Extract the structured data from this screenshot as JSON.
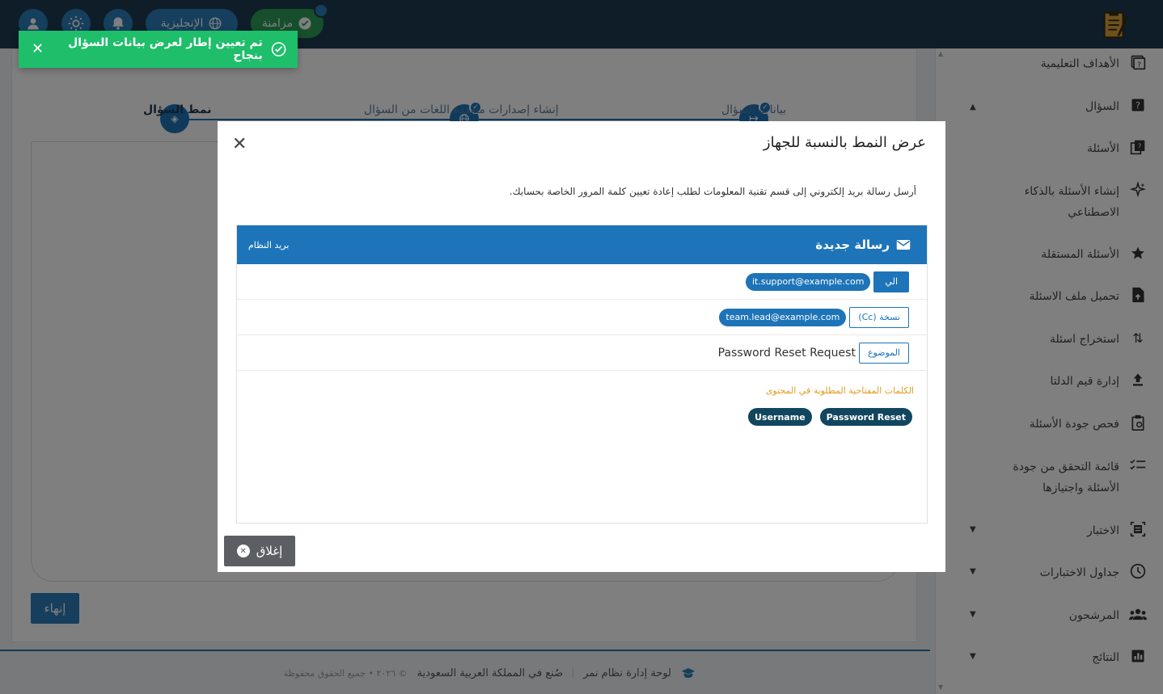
{
  "topbar": {
    "sync_label": "مزامنة",
    "language_label": "الإنجليزية"
  },
  "toast": {
    "message": "تم تعيين إطار لعرض بيانات السؤال بنجاح"
  },
  "stepper": {
    "steps": [
      {
        "label": "بيانات السؤال"
      },
      {
        "label": "إنشاء إصدارات متعددة اللغات من السؤال"
      },
      {
        "label": "نمط السؤال"
      }
    ]
  },
  "main": {
    "finish_label": "إنهاء"
  },
  "footer": {
    "app_name": "لوحة إدارة نظام نمر",
    "made_in": "صُنع في المملكة العربية السعودية",
    "copyright": "© ٢٠٢٦ • جميع الحقوق محفوظة"
  },
  "sidebar": {
    "items": [
      {
        "label": "الأهداف التعليمية",
        "icon": "help-box-icon"
      },
      {
        "label": "السؤال",
        "icon": "question-icon"
      },
      {
        "label": "الأسئلة",
        "icon": "questions-icon"
      },
      {
        "label": "إنشاء الأسئلة بالذكاء الاصطناعي",
        "icon": "sparkle-icon"
      },
      {
        "label": "الأسئلة المستقلة",
        "icon": "star-icon"
      },
      {
        "label": "تحميل ملف الاسئلة",
        "icon": "file-upload-icon"
      },
      {
        "label": "استخراج اسئلة",
        "icon": "swap-icon"
      },
      {
        "label": "إدارة قيم الدلتا",
        "icon": "upload-icon"
      },
      {
        "label": "فحص جودة الأسئلة",
        "icon": "clipboard-icon"
      },
      {
        "label": "قائمة التحقق من جودة الأسئلة واجتيازها",
        "icon": "checklist-icon"
      },
      {
        "label": "الاختبار",
        "icon": "exam-icon"
      },
      {
        "label": "جداول الاختبارات",
        "icon": "clock-icon"
      },
      {
        "label": "المرشحون",
        "icon": "people-icon"
      },
      {
        "label": "النتائج",
        "icon": "chart-icon"
      }
    ]
  },
  "modal": {
    "title": "عرض النمط بالنسبة للجهاز",
    "description": "أرسل رسالة بريد إلكتروني إلى قسم تقنية المعلومات لطلب إعادة تعيين كلمة المرور الخاصة بحسابك.",
    "mail": {
      "header_title": "رسالة جديدة",
      "header_sub": "بريد النظام",
      "to_label": "الي",
      "to_email": "it.support@example.com",
      "cc_label": "نسخة (Cc)",
      "cc_email": "team.lead@example.com",
      "subject_label": "الموضوع",
      "subject_value": "Password Reset Request",
      "keywords_title": "الكلمات المفتاحية المطلوبة في المحتوى",
      "keywords": [
        "Password Reset",
        "Username"
      ]
    },
    "close_label": "إغلاق"
  }
}
